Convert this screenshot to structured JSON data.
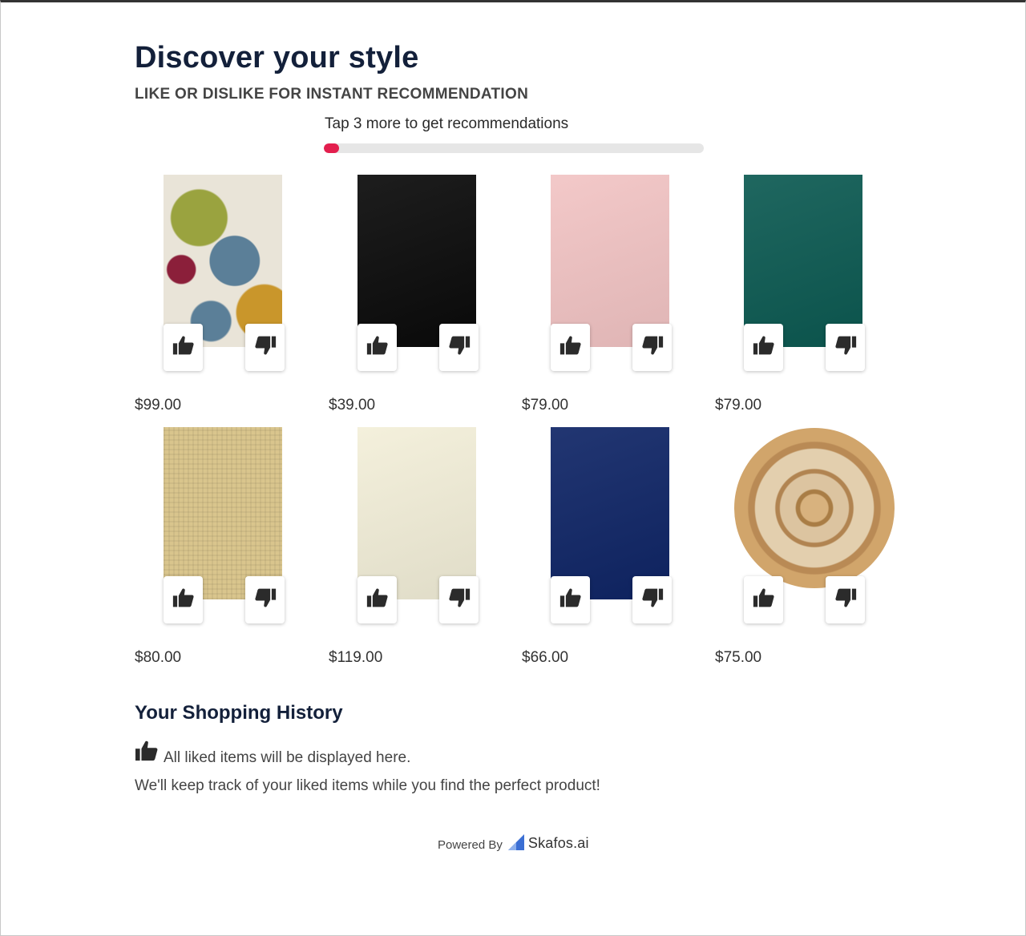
{
  "header": {
    "title": "Discover your style",
    "subtitle": "LIKE OR DISLIKE FOR INSTANT RECOMMENDATION"
  },
  "progress": {
    "label": "Tap 3 more to get recommendations",
    "value": 0.04,
    "color": "#e31f4e"
  },
  "products": [
    {
      "price": "$99.00",
      "style": "abstract",
      "colors": [
        "#e9e4d8",
        "#9aa33f",
        "#8b1f3a",
        "#5b7f98",
        "#c9962b"
      ]
    },
    {
      "price": "$39.00",
      "style": "solid",
      "colors": [
        "#0a0a0a"
      ]
    },
    {
      "price": "$79.00",
      "style": "solid",
      "colors": [
        "#f2c4c4"
      ]
    },
    {
      "price": "$79.00",
      "style": "solid",
      "colors": [
        "#0c5a52"
      ]
    },
    {
      "price": "$80.00",
      "style": "jute",
      "colors": [
        "#d9c58d"
      ]
    },
    {
      "price": "$119.00",
      "style": "solid",
      "colors": [
        "#f3efd9"
      ]
    },
    {
      "price": "$66.00",
      "style": "solid",
      "colors": [
        "#0f2566"
      ]
    },
    {
      "price": "$75.00",
      "style": "round-jute",
      "colors": [
        "#c9a06a"
      ]
    }
  ],
  "buttons": {
    "like_icon": "thumbs-up-icon",
    "dislike_icon": "thumbs-down-icon"
  },
  "history": {
    "title": "Your Shopping History",
    "empty_line1": "All liked items will be displayed here.",
    "empty_line2": "We'll keep track of your liked items while you find the perfect product!"
  },
  "footer": {
    "powered_by": "Powered By",
    "brand": "Skafos.ai",
    "brand_color": "#3b6fd4"
  }
}
